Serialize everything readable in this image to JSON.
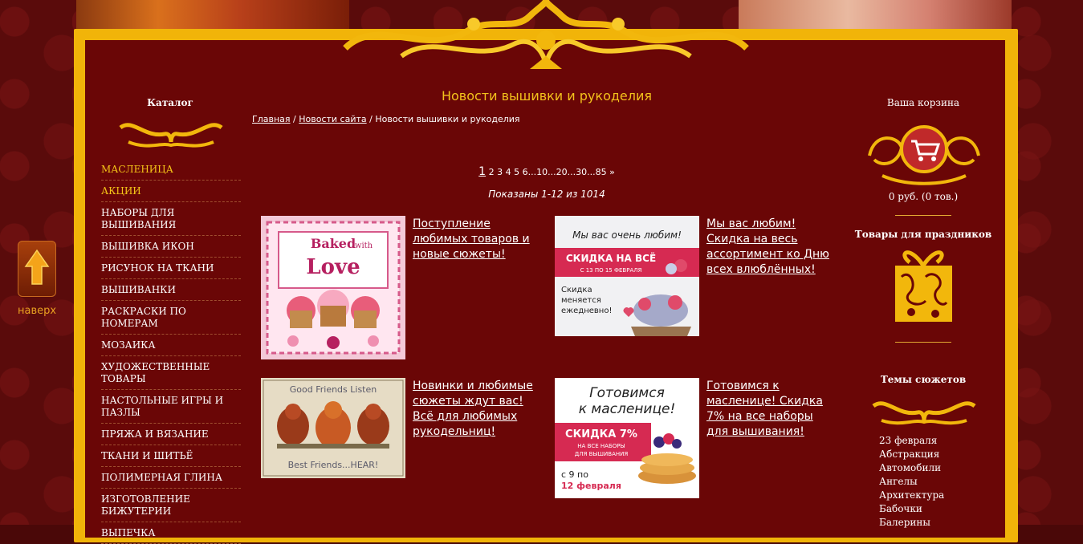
{
  "nav": {
    "to_top_label": "наверх"
  },
  "catalog": {
    "title": "Каталог",
    "items": [
      "МАСЛЕНИЦА",
      "АКЦИИ",
      "НАБОРЫ ДЛЯ ВЫШИВАНИЯ",
      "ВЫШИВКА ИКОН",
      "РИСУНОК НА ТКАНИ",
      "ВЫШИВАНКИ",
      "РАСКРАСКИ ПО НОМЕРАМ",
      "МОЗАИКА",
      "ХУДОЖЕСТВЕННЫЕ ТОВАРЫ",
      "НАСТОЛЬНЫЕ ИГРЫ И ПАЗЛЫ",
      "ПРЯЖА И ВЯЗАНИЕ",
      "ТКАНИ И ШИТЬЁ",
      "ПОЛИМЕРНАЯ ГЛИНА",
      "ИЗГОТОВЛЕНИЕ БИЖУТЕРИИ",
      "ВЫПЕЧКА"
    ]
  },
  "main": {
    "title": "Новости вышивки и рукоделия",
    "breadcrumb": {
      "home": "Главная",
      "news": "Новости сайта",
      "current": "Новости вышивки и рукоделия",
      "sep": "/"
    },
    "pagination": {
      "current": "1",
      "pages": [
        "2",
        "3",
        "4",
        "5",
        "6",
        "...",
        "10",
        "...",
        "20",
        "...",
        "30",
        "...",
        "85"
      ],
      "next": "»"
    },
    "shown_text": "Показаны 1-12 из 1014",
    "news": [
      {
        "title": "Поступление любимых товаров и новые сюжеты!",
        "image_text": [
          "Baked",
          "with",
          "Love"
        ]
      },
      {
        "title": "Мы вас любим! Скидка на весь ассортимент ко Дню всех влюблённых!",
        "image_text": [
          "Мы вас очень любим!",
          "СКИДКА НА ВСЁ",
          "С 13 ПО 15 ФЕВРАЛЯ",
          "Скидка",
          "меняется",
          "ежедневно!"
        ]
      },
      {
        "title": "Новинки и любимые сюжеты ждут вас! Всё для любимых рукодельниц!",
        "image_text": [
          "Good Friends Listen",
          "Best Friends...HEAR!"
        ]
      },
      {
        "title": "Готовимся к масленице! Скидка 7% на все наборы для вышивания!",
        "image_text": [
          "Готовимся",
          "к масленице!",
          "СКИДКА 7%",
          "НА ВСЕ НАБОРЫ",
          "ДЛЯ ВЫШИВАНИЯ",
          "с 9 по",
          "12 февраля"
        ]
      }
    ]
  },
  "cart": {
    "title": "Ваша корзина",
    "summary": "0 руб.   (0 тов.)"
  },
  "holidays": {
    "title": "Товары для праздников"
  },
  "topics": {
    "title": "Темы сюжетов",
    "items": [
      "23 февраля",
      "Абстракция",
      "Автомобили",
      "Ангелы",
      "Архитектура",
      "Бабочки",
      "Балерины"
    ]
  },
  "colors": {
    "gold": "#f1b409",
    "panel": "#6a0606",
    "highlight": "#f5c518",
    "title": "#f3c21c"
  }
}
